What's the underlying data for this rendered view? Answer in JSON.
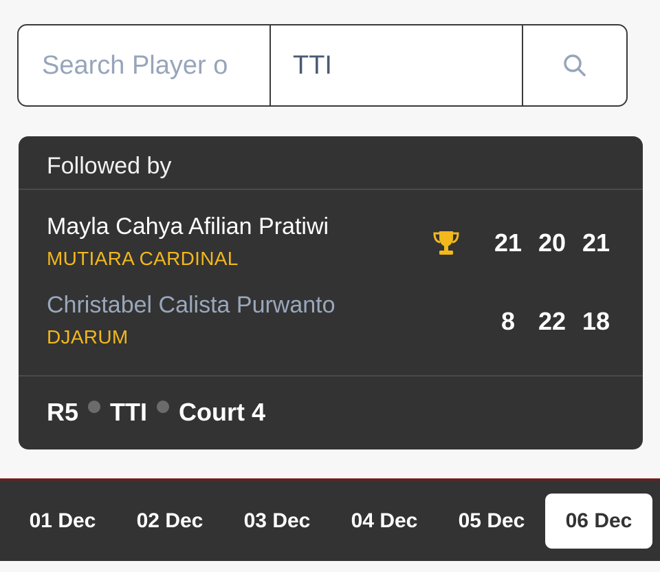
{
  "search": {
    "player_placeholder": "Search Player o",
    "filter_value": "TTI"
  },
  "icons": {
    "search": "search-icon",
    "trophy": "trophy-icon",
    "separator": "dot-icon"
  },
  "colors": {
    "accent": "#f2b81c",
    "card_background": "#333333",
    "loser_name": "#9aa7bc"
  },
  "match": {
    "header": "Followed by",
    "players": [
      {
        "name": "Mayla Cahya Afilian Pratiwi",
        "club": "MUTIARA CARDINAL",
        "winner": true,
        "scores": [
          "21",
          "20",
          "21"
        ]
      },
      {
        "name": "Christabel Calista Purwanto",
        "club": "DJARUM",
        "winner": false,
        "scores": [
          "8",
          "22",
          "18"
        ]
      }
    ],
    "footer": {
      "round": "R5",
      "tournament": "TTI",
      "court": "Court 4"
    }
  },
  "dates": {
    "tabs": [
      "01 Dec",
      "02 Dec",
      "03 Dec",
      "04 Dec",
      "05 Dec",
      "06 Dec"
    ],
    "selected": "06 Dec"
  }
}
